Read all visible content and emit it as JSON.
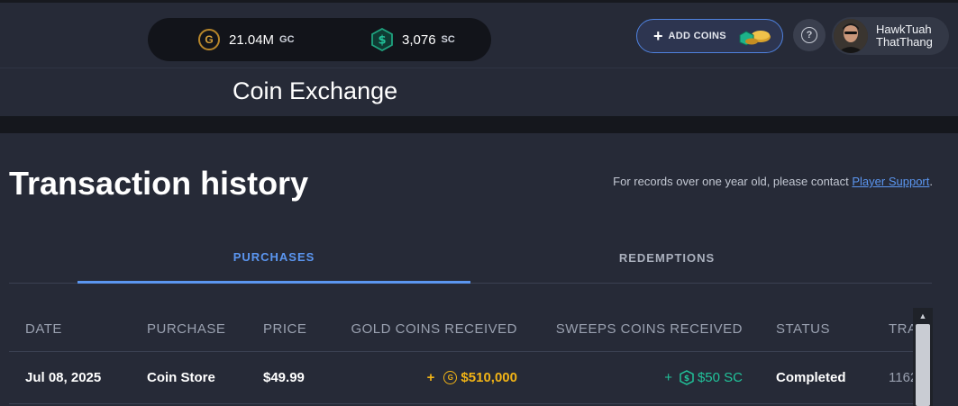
{
  "header": {
    "gold_amount": "21.04M",
    "gold_unit": "GC",
    "sweeps_amount": "3,076",
    "sweeps_unit": "SC",
    "add_coins_label": "ADD COINS",
    "help_icon": "question-icon",
    "user": {
      "name": "HawkTuah ThatThang"
    }
  },
  "page": {
    "title": "Coin Exchange"
  },
  "section": {
    "title": "Transaction history",
    "note_prefix": "For records over one year old, please contact ",
    "note_link": "Player Support",
    "note_suffix": "."
  },
  "tabs": [
    {
      "label": "PURCHASES",
      "active": true
    },
    {
      "label": "REDEMPTIONS",
      "active": false
    }
  ],
  "table": {
    "headers": [
      "DATE",
      "PURCHASE",
      "PRICE",
      "GOLD COINS RECEIVED",
      "SWEEPS COINS RECEIVED",
      "STATUS",
      "TRA"
    ],
    "rows": [
      {
        "date": "Jul 08, 2025",
        "purchase": "Coin Store",
        "price": "$49.99",
        "gold_prefix": "+",
        "gold": "$510,000",
        "sweeps_prefix": "+",
        "sweeps": "$50 SC",
        "status": "Completed",
        "transaction": "1162"
      }
    ]
  },
  "colors": {
    "accent": "#5b96f0",
    "gold": "#f2b416",
    "sweeps": "#21c29a",
    "background": "#262a37"
  }
}
